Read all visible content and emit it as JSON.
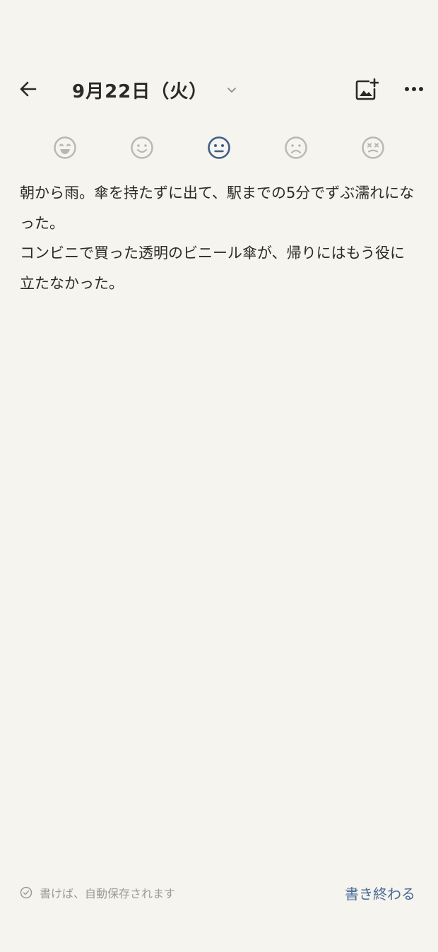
{
  "header": {
    "date_title": "9月22日（火）",
    "back_icon": "arrow-left-icon",
    "dropdown_icon": "chevron-down-icon",
    "add_image_icon": "image-add-icon",
    "more_icon": "more-horizontal-icon"
  },
  "moods": {
    "items": [
      {
        "id": "very-happy",
        "icon": "grin-face-icon",
        "selected": false
      },
      {
        "id": "happy",
        "icon": "smile-face-icon",
        "selected": false
      },
      {
        "id": "neutral",
        "icon": "neutral-face-icon",
        "selected": true
      },
      {
        "id": "sad",
        "icon": "frown-face-icon",
        "selected": false
      },
      {
        "id": "very-sad",
        "icon": "dizzy-face-icon",
        "selected": false
      }
    ],
    "selected_color": "#3e5d86",
    "unselected_color": "#b9b7b2"
  },
  "entry": {
    "paragraphs": [
      "朝から雨。傘を持たずに出て、駅までの5分でずぶ濡れになった。",
      "コンビニで買った透明のビニール傘が、帰りにはもう役に立たなかった。"
    ]
  },
  "footer": {
    "autosave_icon": "check-circle-icon",
    "autosave_text": "書けば、自動保存されます",
    "finish_label": "書き終わる"
  },
  "colors": {
    "background": "#f6f4ee",
    "text": "#2b2b2b",
    "accent": "#4a6b98",
    "muted": "#9a9a9a"
  }
}
